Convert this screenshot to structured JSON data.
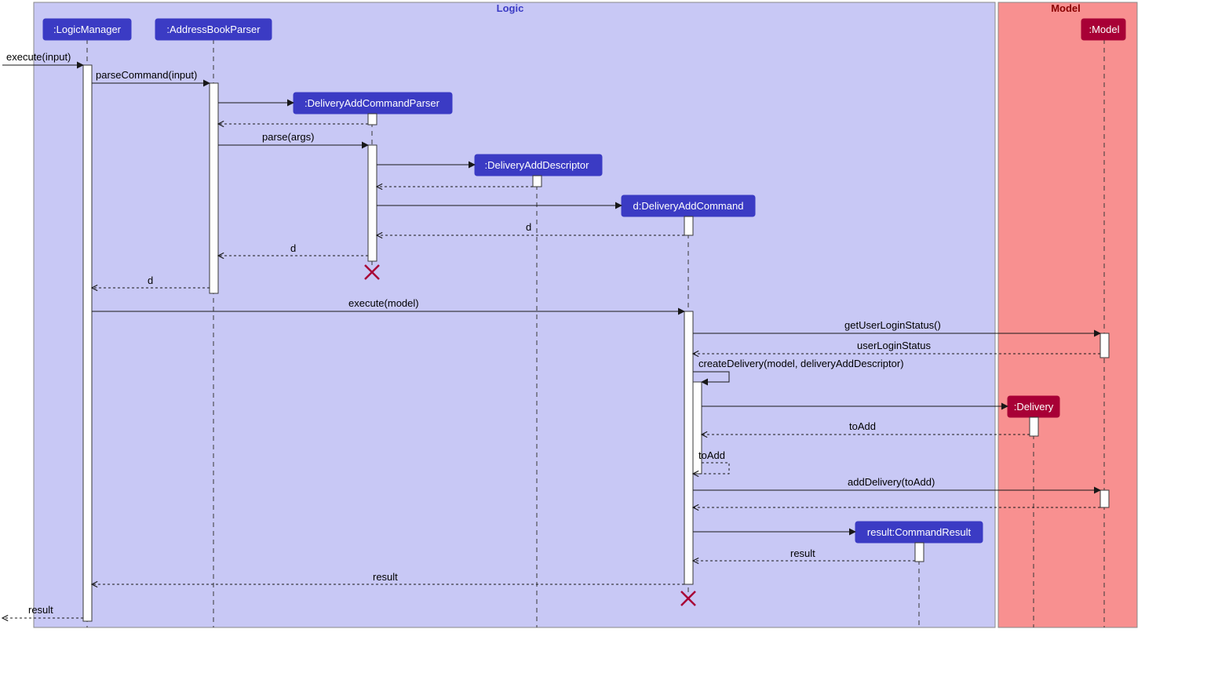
{
  "packages": {
    "logic": "Logic",
    "model": "Model"
  },
  "participants": {
    "p1": ":LogicManager",
    "p2": ":AddressBookParser",
    "p3": ":DeliveryAddCommandParser",
    "p4": ":DeliveryAddDescriptor",
    "p5": "d:DeliveryAddCommand",
    "p6": "result:CommandResult",
    "p7": ":Model",
    "p8": ":Delivery"
  },
  "messages": {
    "m1": "execute(input)",
    "m2": "parseCommand(input)",
    "m3": "parse(args)",
    "m4": "d",
    "m5": "d",
    "m6": "d",
    "m7": "execute(model)",
    "m8": "getUserLoginStatus()",
    "m9": "userLoginStatus",
    "m10": "createDelivery(model, deliveryAddDescriptor)",
    "m11": "toAdd",
    "m12": "toAdd",
    "m13": "addDelivery(toAdd)",
    "m14": "result",
    "m15": "result",
    "m16": "result"
  }
}
